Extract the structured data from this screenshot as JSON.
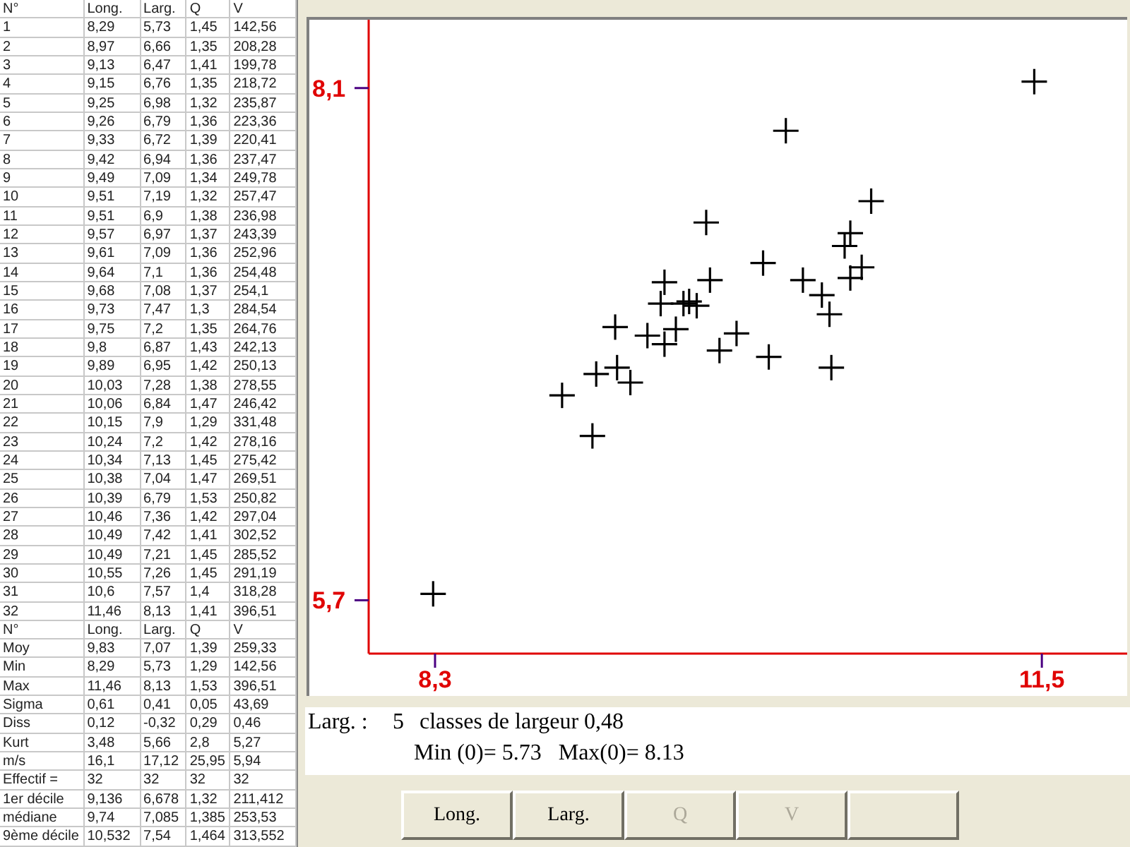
{
  "table": {
    "columns": [
      "N°",
      "Long.",
      "Larg.",
      "Q",
      "V"
    ],
    "rows": [
      [
        "1",
        "8,29",
        "5,73",
        "1,45",
        "142,56"
      ],
      [
        "2",
        "8,97",
        "6,66",
        "1,35",
        "208,28"
      ],
      [
        "3",
        "9,13",
        "6,47",
        "1,41",
        "199,78"
      ],
      [
        "4",
        "9,15",
        "6,76",
        "1,35",
        "218,72"
      ],
      [
        "5",
        "9,25",
        "6,98",
        "1,32",
        "235,87"
      ],
      [
        "6",
        "9,26",
        "6,79",
        "1,36",
        "223,36"
      ],
      [
        "7",
        "9,33",
        "6,72",
        "1,39",
        "220,41"
      ],
      [
        "8",
        "9,42",
        "6,94",
        "1,36",
        "237,47"
      ],
      [
        "9",
        "9,49",
        "7,09",
        "1,34",
        "249,78"
      ],
      [
        "10",
        "9,51",
        "7,19",
        "1,32",
        "257,47"
      ],
      [
        "11",
        "9,51",
        "6,9",
        "1,38",
        "236,98"
      ],
      [
        "12",
        "9,57",
        "6,97",
        "1,37",
        "243,39"
      ],
      [
        "13",
        "9,61",
        "7,09",
        "1,36",
        "252,96"
      ],
      [
        "14",
        "9,64",
        "7,1",
        "1,36",
        "254,48"
      ],
      [
        "15",
        "9,68",
        "7,08",
        "1,37",
        "254,1"
      ],
      [
        "16",
        "9,73",
        "7,47",
        "1,3",
        "284,54"
      ],
      [
        "17",
        "9,75",
        "7,2",
        "1,35",
        "264,76"
      ],
      [
        "18",
        "9,8",
        "6,87",
        "1,43",
        "242,13"
      ],
      [
        "19",
        "9,89",
        "6,95",
        "1,42",
        "250,13"
      ],
      [
        "20",
        "10,03",
        "7,28",
        "1,38",
        "278,55"
      ],
      [
        "21",
        "10,06",
        "6,84",
        "1,47",
        "246,42"
      ],
      [
        "22",
        "10,15",
        "7,9",
        "1,29",
        "331,48"
      ],
      [
        "23",
        "10,24",
        "7,2",
        "1,42",
        "278,16"
      ],
      [
        "24",
        "10,34",
        "7,13",
        "1,45",
        "275,42"
      ],
      [
        "25",
        "10,38",
        "7,04",
        "1,47",
        "269,51"
      ],
      [
        "26",
        "10,39",
        "6,79",
        "1,53",
        "250,82"
      ],
      [
        "27",
        "10,46",
        "7,36",
        "1,42",
        "297,04"
      ],
      [
        "28",
        "10,49",
        "7,42",
        "1,41",
        "302,52"
      ],
      [
        "29",
        "10,49",
        "7,21",
        "1,45",
        "285,52"
      ],
      [
        "30",
        "10,55",
        "7,26",
        "1,45",
        "291,19"
      ],
      [
        "31",
        "10,6",
        "7,57",
        "1,4",
        "318,28"
      ],
      [
        "32",
        "11,46",
        "8,13",
        "1,41",
        "396,51"
      ]
    ]
  },
  "stats": {
    "columns": [
      "N°",
      "Long.",
      "Larg.",
      "Q",
      "V"
    ],
    "rows": [
      [
        "Moy",
        "9,83",
        "7,07",
        "1,39",
        "259,33"
      ],
      [
        "Min",
        "8,29",
        "5,73",
        "1,29",
        "142,56"
      ],
      [
        "Max",
        "11,46",
        "8,13",
        "1,53",
        "396,51"
      ],
      [
        "Sigma",
        "0,61",
        "0,41",
        "0,05",
        "43,69"
      ],
      [
        "Diss",
        "0,12",
        "-0,32",
        "0,29",
        "0,46"
      ],
      [
        "Kurt",
        "3,48",
        "5,66",
        "2,8",
        "5,27"
      ],
      [
        "m/s",
        "16,1",
        "17,12",
        "25,95",
        "5,94"
      ],
      [
        "Effectif =",
        "32",
        "32",
        "32",
        "32"
      ],
      [
        "1er décile",
        "9,136",
        "6,678",
        "1,32",
        "211,412"
      ],
      [
        "médiane",
        "9,74",
        "7,085",
        "1,385",
        "253,53"
      ],
      [
        "9ème décile",
        "10,532",
        "7,54",
        "1,464",
        "313,552"
      ]
    ]
  },
  "plot": {
    "chart_data": {
      "type": "scatter",
      "x": [
        8.29,
        8.97,
        9.13,
        9.15,
        9.25,
        9.26,
        9.33,
        9.42,
        9.49,
        9.51,
        9.51,
        9.57,
        9.61,
        9.64,
        9.68,
        9.73,
        9.75,
        9.8,
        9.89,
        10.03,
        10.06,
        10.15,
        10.24,
        10.34,
        10.38,
        10.39,
        10.46,
        10.49,
        10.49,
        10.55,
        10.6,
        11.46
      ],
      "series": [
        {
          "color": "#000000",
          "values": [
            5.73,
            6.66,
            6.47,
            6.76,
            6.98,
            6.79,
            6.72,
            6.94,
            7.09,
            7.19,
            6.9,
            6.97,
            7.09,
            7.1,
            7.08,
            7.47,
            7.2,
            6.87,
            6.95,
            7.28,
            6.84,
            7.9,
            7.2,
            7.13,
            7.04,
            6.79,
            7.36,
            7.42,
            7.21,
            7.26,
            7.57,
            8.13
          ]
        }
      ],
      "xlim": [
        7.95,
        11.95
      ],
      "ylim": [
        5.45,
        8.42
      ],
      "xticks": [
        {
          "value": 8.3,
          "label": "8,3"
        },
        {
          "value": 11.5,
          "label": "11,5"
        }
      ],
      "yticks": [
        {
          "value": 5.7,
          "label": "5,7"
        },
        {
          "value": 8.1,
          "label": "8,1"
        }
      ]
    }
  },
  "summary": {
    "label": "Larg. :",
    "classes": "5",
    "description": "classes de largeur 0,48",
    "range": "Min (0)= 5.73   Max(0)= 8.13"
  },
  "buttons": [
    {
      "kind": "text",
      "label": "Long.",
      "disabled": false
    },
    {
      "kind": "text",
      "label": "Larg.",
      "disabled": false
    },
    {
      "kind": "text",
      "label": "Q",
      "disabled": true
    },
    {
      "kind": "text",
      "label": "V",
      "disabled": true
    },
    {
      "kind": "blank"
    }
  ]
}
